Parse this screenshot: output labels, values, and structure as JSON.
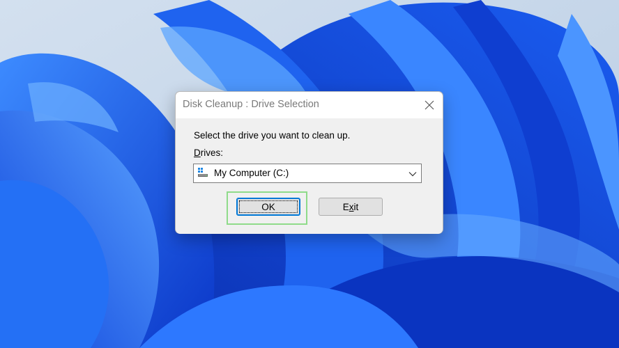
{
  "dialog": {
    "title": "Disk Cleanup : Drive Selection",
    "prompt": "Select the drive you want to clean up.",
    "drives_label_mnemonic": "D",
    "drives_label_rest": "rives:",
    "selected_drive": "My Computer (C:)",
    "ok_label": "OK",
    "exit_label_pre": "E",
    "exit_label_mnemonic": "x",
    "exit_label_rest": "it"
  },
  "colors": {
    "wallpaper_deep": "#0a3fd6",
    "wallpaper_bright": "#2f7bff",
    "background": "#c7d7ea",
    "focus_highlight": "#8fdb8a",
    "button_accent": "#0078d7"
  },
  "icons": {
    "close": "close-icon",
    "drive": "computer-drive-icon",
    "dropdown": "chevron-down-icon"
  }
}
